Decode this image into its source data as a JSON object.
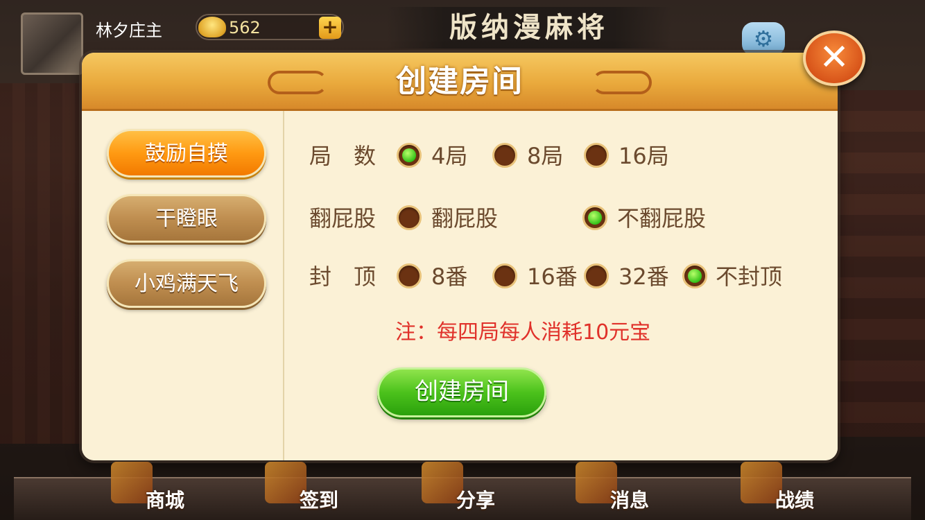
{
  "top": {
    "username": "林夕庄主",
    "coins": "562",
    "coin_plus": "+",
    "logo_text": "版纳漫麻将",
    "settings_icon": "gear-icon"
  },
  "dialog": {
    "title": "创建房间",
    "close_label": "✕",
    "modes": [
      {
        "label": "鼓励自摸",
        "selected": true
      },
      {
        "label": "干瞪眼",
        "selected": false
      },
      {
        "label": "小鸡满天飞",
        "selected": false
      }
    ],
    "rounds": {
      "label": "局　数",
      "options": [
        {
          "label": "4局",
          "selected": true
        },
        {
          "label": "8局",
          "selected": false
        },
        {
          "label": "16局",
          "selected": false
        }
      ]
    },
    "flip": {
      "label": "翻屁股",
      "options": [
        {
          "label": "翻屁股",
          "selected": false
        },
        {
          "label": "不翻屁股",
          "selected": true
        }
      ]
    },
    "cap": {
      "label": "封　顶",
      "options": [
        {
          "label": "8番",
          "selected": false
        },
        {
          "label": "16番",
          "selected": false
        },
        {
          "label": "32番",
          "selected": false
        },
        {
          "label": "不封顶",
          "selected": true
        }
      ]
    },
    "note": "注：每四局每人消耗10元宝",
    "create_button": "创建房间"
  },
  "bottom_nav": [
    {
      "label": "商城",
      "icon": "shop-icon"
    },
    {
      "label": "签到",
      "icon": "checkin-icon"
    },
    {
      "label": "分享",
      "icon": "share-icon"
    },
    {
      "label": "消息",
      "icon": "message-icon"
    },
    {
      "label": "战绩",
      "icon": "record-icon"
    }
  ],
  "colors": {
    "header_orange": "#e9a93c",
    "panel_cream": "#fbf1d6",
    "text_brown": "#6b4a2e",
    "note_red": "#e0312a",
    "radio_on": "#35c21a",
    "create_green": "#4cc21c"
  }
}
